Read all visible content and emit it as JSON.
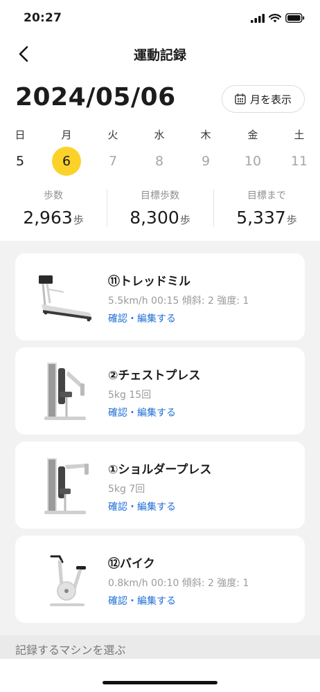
{
  "status": {
    "time": "20:27"
  },
  "nav": {
    "title": "運動記録"
  },
  "date": "2024/05/06",
  "month_button": "月を表示",
  "week": [
    {
      "dow": "日",
      "num": "5",
      "state": "past"
    },
    {
      "dow": "月",
      "num": "6",
      "state": "selected"
    },
    {
      "dow": "火",
      "num": "7",
      "state": "future"
    },
    {
      "dow": "水",
      "num": "8",
      "state": "future"
    },
    {
      "dow": "木",
      "num": "9",
      "state": "future"
    },
    {
      "dow": "金",
      "num": "10",
      "state": "future"
    },
    {
      "dow": "土",
      "num": "11",
      "state": "future"
    }
  ],
  "stats": [
    {
      "label": "歩数",
      "value": "2,963",
      "unit": "歩"
    },
    {
      "label": "目標歩数",
      "value": "8,300",
      "unit": "歩"
    },
    {
      "label": "目標まで",
      "value": "5,337",
      "unit": "歩"
    }
  ],
  "machines": [
    {
      "title": "⑪トレッドミル",
      "detail": "5.5km/h 00:15 傾斜: 2 強度: 1",
      "link": "確認・編集する",
      "image": "treadmill-image"
    },
    {
      "title": "②チェストプレス",
      "detail": "5kg 15回",
      "link": "確認・編集する",
      "image": "chest-press-image"
    },
    {
      "title": "①ショルダープレス",
      "detail": "5kg 7回",
      "link": "確認・編集する",
      "image": "shoulder-press-image"
    },
    {
      "title": "⑫バイク",
      "detail": "0.8km/h 00:10 傾斜: 2 強度: 1",
      "link": "確認・編集する",
      "image": "bike-image"
    }
  ],
  "select_machine": "記録するマシンを選ぶ",
  "colors": {
    "accent_yellow": "#fbd22a",
    "link_blue": "#1f6fd6"
  }
}
